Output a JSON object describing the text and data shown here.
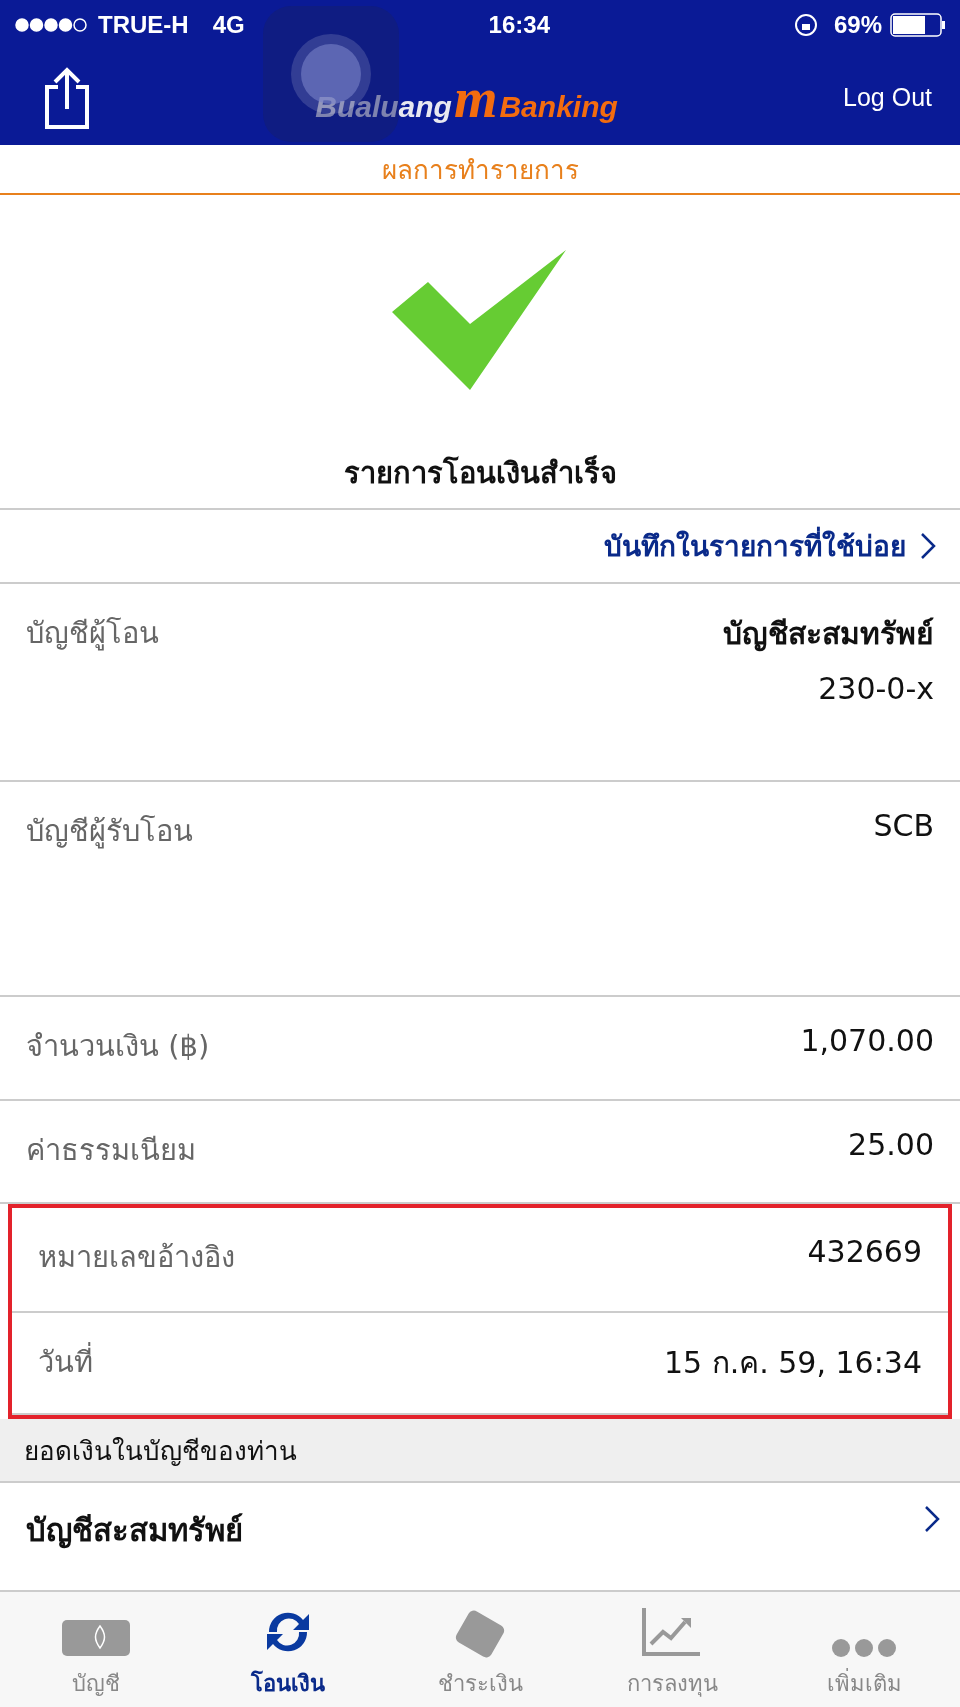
{
  "status_bar": {
    "carrier": "TRUE-H",
    "network": "4G",
    "time": "16:34",
    "battery": "69%"
  },
  "header": {
    "logo": {
      "left": "Bualuang",
      "mark": "m",
      "right": "Banking"
    },
    "logout": "Log Out"
  },
  "page_title": "ผลการทำรายการ",
  "result": {
    "message": "รายการโอนเงินสำเร็จ"
  },
  "favorite_link": "บันทึกในรายการที่ใช้บ่อย",
  "details": [
    {
      "label": "บัญชีผู้โอน",
      "values": [
        "บัญชีสะสมทรัพย์",
        "230-0-x"
      ],
      "highlighted": false
    },
    {
      "label": "บัญชีผู้รับโอน",
      "values": [
        "SCB"
      ],
      "highlighted": false
    },
    {
      "label": "จำนวนเงิน (฿)",
      "values": [
        "1,070.00"
      ],
      "highlighted": false
    },
    {
      "label": "ค่าธรรมเนียม",
      "values": [
        "25.00"
      ],
      "highlighted": false
    },
    {
      "label": "หมายเลขอ้างอิง",
      "values": [
        "432669"
      ],
      "highlighted": true
    },
    {
      "label": "วันที่",
      "values": [
        "15 ก.ค. 59, 16:34"
      ],
      "highlighted": true
    }
  ],
  "balance_section": {
    "title": "ยอดเงินในบัญชีของท่าน",
    "account": "บัญชีสะสมทรัพย์"
  },
  "tabs": [
    {
      "kind": "account",
      "label": "บัญชี",
      "selected": false
    },
    {
      "kind": "transfer",
      "label": "โอนเงิน",
      "selected": true
    },
    {
      "kind": "pay",
      "label": "ชำระเงิน",
      "selected": false
    },
    {
      "kind": "invest",
      "label": "การลงทุน",
      "selected": false
    },
    {
      "kind": "more",
      "label": "เพิ่มเติม",
      "selected": false
    }
  ]
}
